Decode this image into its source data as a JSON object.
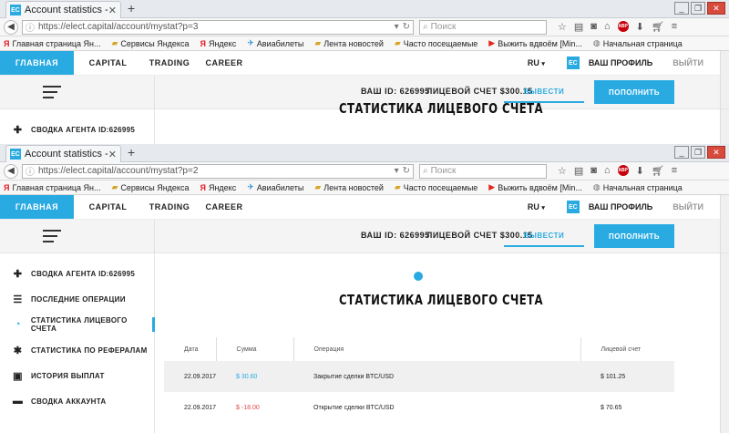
{
  "browser": {
    "tab_title": "Account statistics - Elect",
    "favicon": "EC",
    "new_tab": "+",
    "search_placeholder": "Поиск",
    "window_controls": [
      "_",
      "❐",
      "✕"
    ]
  },
  "window1": {
    "url": "https://elect.capital/account/mystat?p=3"
  },
  "window2": {
    "url": "https://elect.capital/account/mystat?p=2"
  },
  "bookmarks": [
    {
      "label": "Главная страница Ян...",
      "icon": "yandex-icon",
      "glyph": "Я"
    },
    {
      "label": "Сервисы Яндекса",
      "icon": "folder-icon",
      "glyph": "▰"
    },
    {
      "label": "Яндекс",
      "icon": "yandex-icon",
      "glyph": "Я"
    },
    {
      "label": "Авиабилеты",
      "icon": "plane-icon",
      "glyph": "✈"
    },
    {
      "label": "Лента новостей",
      "icon": "folder-icon",
      "glyph": "▰"
    },
    {
      "label": "Часто посещаемые",
      "icon": "folder-icon",
      "glyph": "▰"
    },
    {
      "label": "Выжить вдвоём [Min...",
      "icon": "youtube-icon",
      "glyph": "▶"
    },
    {
      "label": "Начальная страница",
      "icon": "globe-icon",
      "glyph": "◍"
    }
  ],
  "site": {
    "menu": [
      "ГЛАВНАЯ",
      "CAPITAL",
      "TRADING",
      "CAREER"
    ],
    "lang": "RU",
    "lang_arrow": "▾",
    "logo": "EC",
    "profile": "ВАШ ПРОФИЛЬ",
    "logout": "ВЫЙТИ",
    "your_id": "ВАШ ID: 626995",
    "balance": "ЛИЦЕВОЙ СЧЕТ $300.15",
    "withdraw": "ВЫВЕСТИ",
    "deposit": "ПОПОЛНИТЬ"
  },
  "sidebar": {
    "items": [
      {
        "label": "СВОДКА АГЕНТА ID:626995",
        "icon": "gamepad-icon",
        "glyph": "✚"
      },
      {
        "label": "ПОСЛЕДНИЕ ОПЕРАЦИИ",
        "icon": "list-icon",
        "glyph": "☰"
      },
      {
        "label": "СТАТИСТИКА ЛИЦЕВОГО СЧЕТА",
        "icon": "pie-chart-icon",
        "glyph": "◔"
      },
      {
        "label": "СТАТИСТИКА ПО РЕФЕРАЛАМ",
        "icon": "puzzle-icon",
        "glyph": "✱"
      },
      {
        "label": "ИСТОРИЯ ВЫПЛАТ",
        "icon": "briefcase-icon",
        "glyph": "▣"
      },
      {
        "label": "СВОДКА АККАУНТА",
        "icon": "card-icon",
        "glyph": "▬"
      }
    ]
  },
  "page": {
    "title": "СТАТИСТИКА ЛИЦЕВОГО СЧЕТА"
  },
  "table": {
    "headers": [
      "Дата",
      "Сумма",
      "Операция",
      "Лицевой счет"
    ],
    "rows": [
      {
        "date": "22.09.2017",
        "amount": "$ 30.60",
        "operation": "Закрытие сделки BTC/USD",
        "balance": "$ 101.25"
      },
      {
        "date": "22.09.2017",
        "amount": "$ -18.00",
        "operation": "Открытие сделки BTC/USD",
        "balance": "$ 70.65"
      }
    ]
  },
  "colors": {
    "accent": "#29abe2",
    "negative": "#e24545"
  }
}
